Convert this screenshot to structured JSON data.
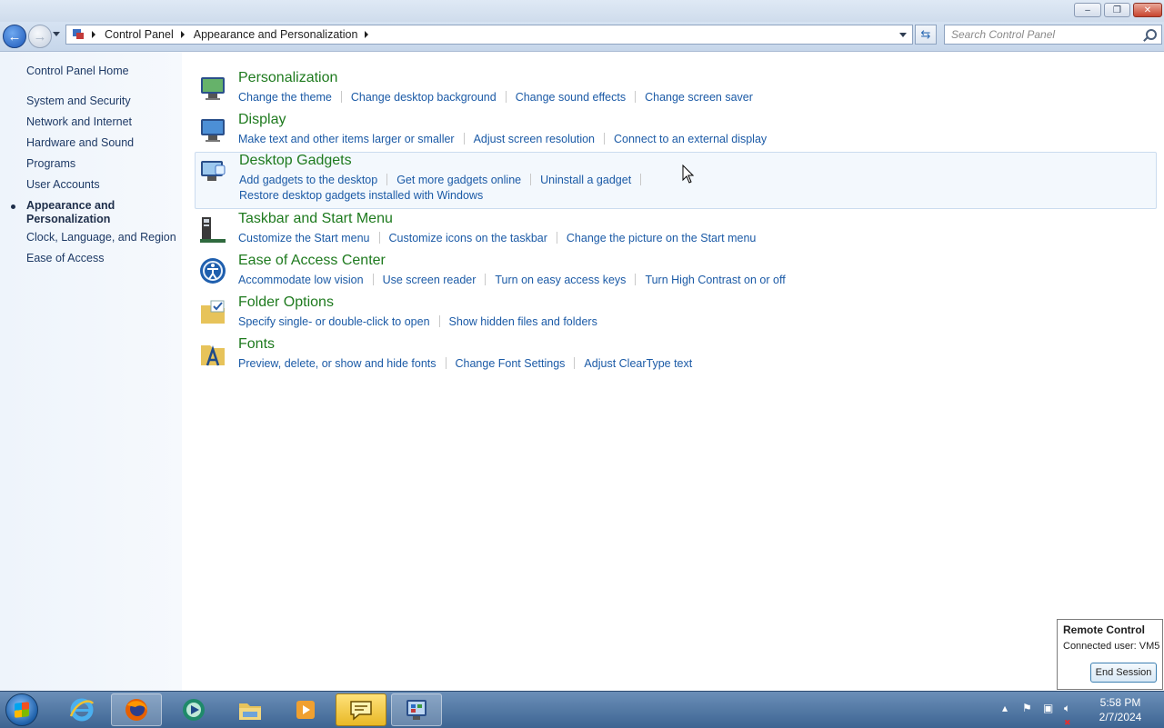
{
  "breadcrumb": {
    "root": "Control Panel",
    "current": "Appearance and Personalization"
  },
  "search": {
    "placeholder": "Search Control Panel"
  },
  "sidebar": {
    "home": "Control Panel Home",
    "items": [
      {
        "label": "System and Security"
      },
      {
        "label": "Network and Internet"
      },
      {
        "label": "Hardware and Sound"
      },
      {
        "label": "Programs"
      },
      {
        "label": "User Accounts"
      },
      {
        "label": "Appearance and Personalization",
        "line1": "Appearance and",
        "line2": "Personalization",
        "selected": true
      },
      {
        "label": "Clock, Language, and Region"
      },
      {
        "label": "Ease of Access"
      }
    ]
  },
  "categories": [
    {
      "title": "Personalization",
      "icon": "personalization-icon",
      "links": [
        "Change the theme",
        "Change desktop background",
        "Change sound effects",
        "Change screen saver"
      ]
    },
    {
      "title": "Display",
      "icon": "display-icon",
      "links": [
        "Make text and other items larger or smaller",
        "Adjust screen resolution",
        "Connect to an external display"
      ]
    },
    {
      "title": "Desktop Gadgets",
      "icon": "gadgets-icon",
      "links": [
        "Add gadgets to the desktop",
        "Get more gadgets online",
        "Uninstall a gadget",
        "Restore desktop gadgets installed with Windows"
      ]
    },
    {
      "title": "Taskbar and Start Menu",
      "icon": "taskbar-icon",
      "links": [
        "Customize the Start menu",
        "Customize icons on the taskbar",
        "Change the picture on the Start menu"
      ]
    },
    {
      "title": "Ease of Access Center",
      "icon": "ease-of-access-icon",
      "links": [
        "Accommodate low vision",
        "Use screen reader",
        "Turn on easy access keys",
        "Turn High Contrast on or off"
      ]
    },
    {
      "title": "Folder Options",
      "icon": "folder-options-icon",
      "links": [
        "Specify single- or double-click to open",
        "Show hidden files and folders"
      ]
    },
    {
      "title": "Fonts",
      "icon": "fonts-icon",
      "links": [
        "Preview, delete, or show and hide fonts",
        "Change Font Settings",
        "Adjust ClearType text"
      ]
    }
  ],
  "remote": {
    "title": "Remote Control",
    "user": "Connected user: VM5",
    "button": "End Session"
  },
  "clock": {
    "time": "5:58 PM",
    "date": "2/7/2024"
  },
  "taskbar_apps": [
    "internet-explorer-icon",
    "firefox-icon",
    "media-player-icon",
    "file-explorer-icon",
    "video-icon",
    "chat-icon",
    "control-panel-icon"
  ]
}
